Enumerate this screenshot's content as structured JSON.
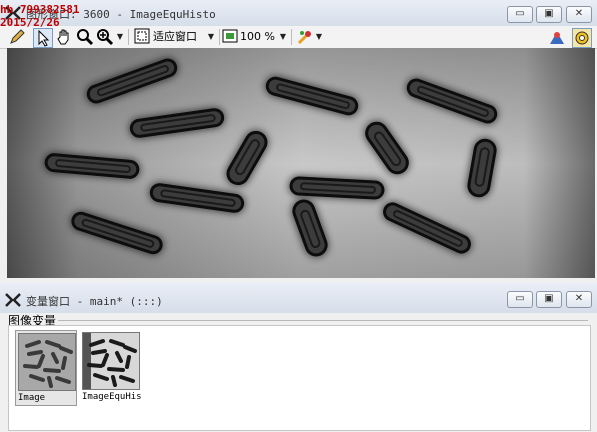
{
  "watermark": {
    "line1": "hb 799382581",
    "line2": "2015/2/26"
  },
  "graphics_window": {
    "title_cjk": "图形窗口",
    "title_rest": ": 3600 - ImageEquHisto",
    "controls": {
      "minimize": "▭",
      "restore": "▣",
      "close": "✕"
    }
  },
  "toolbar": {
    "fit_mode": "适应窗口",
    "zoom": "100 %",
    "icons": [
      "pencil-icon",
      "pointer-icon",
      "hand-icon",
      "zoom-icon",
      "zoom-plus-icon",
      "fit-window-icon",
      "zoom-level-icon",
      "paint-icon",
      "inspect-icon",
      "settings-icon"
    ]
  },
  "variable_window": {
    "title_cjk": "变量窗口",
    "title_rest": " - main* (:::)",
    "section_label": "图像变量",
    "variables": [
      {
        "name": "Image",
        "selected": true
      },
      {
        "name": "ImageEquHis",
        "selected": false
      }
    ],
    "controls": {
      "minimize": "▭",
      "restore": "▣",
      "close": "✕"
    }
  },
  "colors": {
    "titlebar": "#dfe6f0",
    "watermark": "#c00000"
  }
}
